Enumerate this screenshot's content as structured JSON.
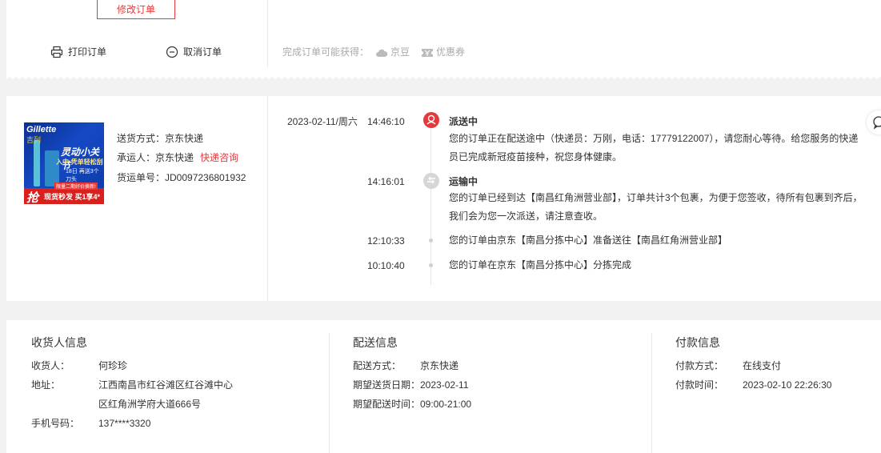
{
  "order_actions": {
    "modify_label": "修改订单",
    "print_label": "打印订单",
    "cancel_label": "取消订单",
    "rewards_prefix": "完成订单可能获得：",
    "reward_jingdou": "京豆",
    "reward_coupon": "优惠券"
  },
  "shipment": {
    "method": "送货方式：京东快递",
    "carrier_label": "承运人：京东快递",
    "carrier_link": "快递咨询",
    "waybill": "货运单号：JD0097236801932",
    "product_image_text": {
      "brand": "Gillette",
      "brand_cn": "吉列",
      "promo_title": "灵动小关节",
      "promo_sub": "入中·凭单轻松刮",
      "promo_small": "18日 再送3个刀头",
      "tag": "限量二期好价换新!",
      "grab": "抢",
      "stripe": "现货秒发 买1享4*"
    }
  },
  "timeline": {
    "date": "2023-02-11/周六",
    "events": [
      {
        "time": "14:46:10",
        "status": "派送中",
        "text": "您的订单正在配送途中（快递员：万刚，电话：17779122007），请您耐心等待。给您服务的快递员已完成新冠疫苗接种，祝您身体健康。"
      },
      {
        "time": "14:16:01",
        "status": "运输中",
        "text": "您的订单已经到达【南昌红角洲营业部】，订单共计3个包裹，为便于您签收，待所有包裹到齐后，我们会为您一次派送，请注意查收。"
      },
      {
        "time": "12:10:33",
        "text": "您的订单由京东【南昌分拣中心】准备送往【南昌红角洲营业部】"
      },
      {
        "time": "10:10:40",
        "text": "您的订单在京东【南昌分拣中心】分拣完成"
      }
    ]
  },
  "consignee": {
    "title": "收货人信息",
    "name_label": "收货人：",
    "name": "何珍珍",
    "address_label": "地址：",
    "address_line1": "江西南昌市红谷滩区红谷滩中心",
    "address_line2": "区红角洲学府大道666号",
    "phone_label": "手机号码：",
    "phone": "137****3320"
  },
  "delivery": {
    "title": "配送信息",
    "method_label": "配送方式：",
    "method": "京东快递",
    "date_label": "期望送货日期：",
    "date": "2023-02-11",
    "time_label": "期望配送时间：",
    "time": "09:00-21:00"
  },
  "payment": {
    "title": "付款信息",
    "method_label": "付款方式：",
    "method": "在线支付",
    "time_label": "付款时间：",
    "time": "2023-02-10 22:26:30"
  },
  "colors": {
    "accent": "#e4393c",
    "background": "#f2f2f2",
    "muted": "#aaaaaa"
  },
  "icons": [
    "printer-icon",
    "cancel-circle-icon",
    "cloud-icon",
    "coupon-icon",
    "delivery-person-icon",
    "transit-icon",
    "chat-icon"
  ]
}
